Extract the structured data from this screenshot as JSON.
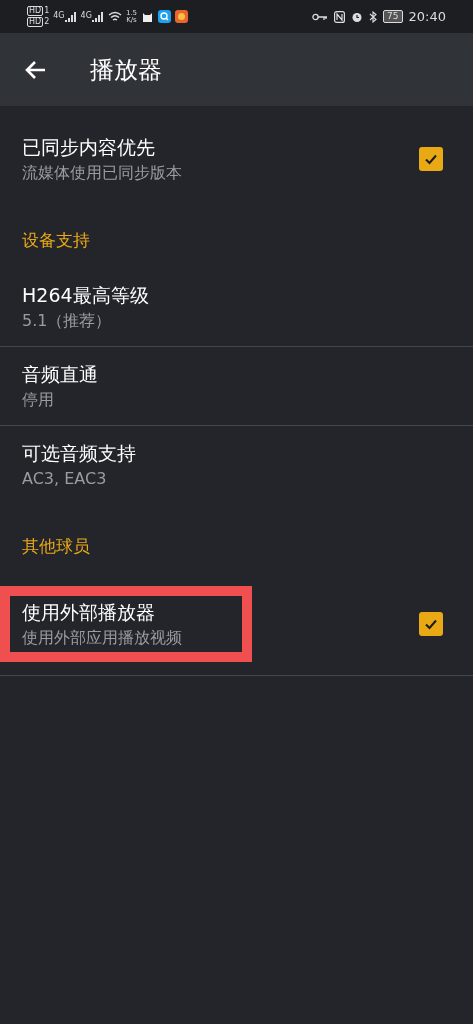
{
  "status_bar": {
    "sim_labels": [
      "HD",
      "HD"
    ],
    "sim_numbers": [
      "1",
      "2"
    ],
    "network_labels": [
      "4G",
      "4G"
    ],
    "speed_value": "1.5",
    "speed_unit": "K/s",
    "battery": "75",
    "time": "20:40"
  },
  "header": {
    "title": "播放器"
  },
  "items": [
    {
      "kind": "checkbox",
      "title": "已同步内容优先",
      "subtitle": "流媒体使用已同步版本",
      "checked": true,
      "highlighted": false
    },
    {
      "kind": "section",
      "title": "设备支持"
    },
    {
      "kind": "choice",
      "title": "H264最高等级",
      "subtitle": "5.1（推荐）",
      "highlighted": false
    },
    {
      "kind": "choice",
      "title": "音频直通",
      "subtitle": "停用",
      "highlighted": false
    },
    {
      "kind": "choice",
      "title": "可选音频支持",
      "subtitle": "AC3, EAC3",
      "highlighted": false
    },
    {
      "kind": "section",
      "title": "其他球员"
    },
    {
      "kind": "checkbox",
      "title": "使用外部播放器",
      "subtitle": "使用外部应用播放视频",
      "checked": true,
      "highlighted": true
    }
  ]
}
